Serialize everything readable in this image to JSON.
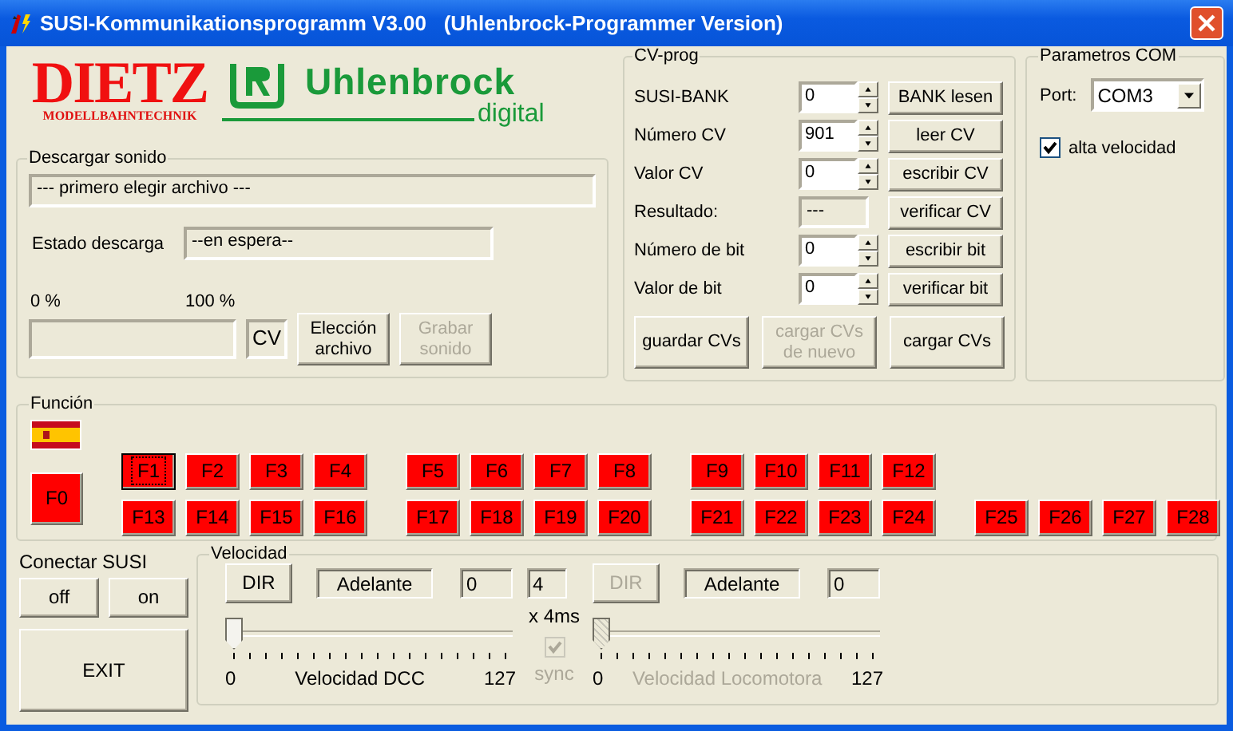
{
  "window": {
    "title": "SUSI-Kommunikationsprogramm V3.00   (Uhlenbrock-Programmer Version)"
  },
  "logos": {
    "dietz": "DIETZ",
    "dietz_sub": "MODELLBAHNTECHNIK",
    "uhlenbrock": "Uhlenbrock",
    "uhlenbrock_sub": "digital"
  },
  "download": {
    "title": "Descargar sonido",
    "file": "--- primero elegir archivo ---",
    "status_label": "Estado descarga",
    "status": "--en espera--",
    "progress_min": "0 %",
    "progress_max": "100 %",
    "progress": {
      "level": 0
    },
    "cv_box": "CV",
    "buttons": [
      {
        "label": "Elección archivo",
        "disabled": false
      },
      {
        "label": "Grabar sonido",
        "disabled": true
      }
    ]
  },
  "cv_prog": {
    "title": "CV-prog",
    "rows": [
      {
        "label": "SUSI-BANK",
        "kind": "spin",
        "value": "0",
        "button": "BANK lesen"
      },
      {
        "label": "Número CV",
        "kind": "spin",
        "value": "901",
        "button": "leer CV"
      },
      {
        "label": "Valor CV",
        "kind": "spin",
        "value": "0",
        "button": "escribir CV"
      },
      {
        "label": "Resultado:",
        "kind": "readout",
        "value": "---",
        "button": "verificar CV"
      },
      {
        "label": "Número de bit",
        "kind": "spin",
        "value": "0",
        "button": "escribir bit"
      },
      {
        "label": "Valor de bit",
        "kind": "spin",
        "value": "0",
        "button": "verificar bit"
      }
    ],
    "buttons": [
      {
        "label": "guardar CVs",
        "disabled": false
      },
      {
        "label": "cargar CVs de nuevo",
        "disabled": true
      },
      {
        "label": "cargar CVs",
        "disabled": false
      }
    ]
  },
  "com": {
    "title": "Parametros COM",
    "port_label": "Port:",
    "port": "COM3",
    "high_speed": {
      "label": "alta velocidad",
      "checked": true
    }
  },
  "functions": {
    "title": "Función",
    "f0": "F0",
    "rows": [
      [
        [
          {
            "label": "F1",
            "focused": true
          },
          {
            "label": "F2",
            "focused": false
          },
          {
            "label": "F3",
            "focused": false
          },
          {
            "label": "F4",
            "focused": false
          }
        ],
        [
          {
            "label": "F5",
            "focused": false
          },
          {
            "label": "F6",
            "focused": false
          },
          {
            "label": "F7",
            "focused": false
          },
          {
            "label": "F8",
            "focused": false
          }
        ],
        [
          {
            "label": "F9",
            "focused": false
          },
          {
            "label": "F10",
            "focused": false
          },
          {
            "label": "F11",
            "focused": false
          },
          {
            "label": "F12",
            "focused": false
          }
        ]
      ],
      [
        [
          {
            "label": "F13",
            "focused": false
          },
          {
            "label": "F14",
            "focused": false
          },
          {
            "label": "F15",
            "focused": false
          },
          {
            "label": "F16",
            "focused": false
          }
        ],
        [
          {
            "label": "F17",
            "focused": false
          },
          {
            "label": "F18",
            "focused": false
          },
          {
            "label": "F19",
            "focused": false
          },
          {
            "label": "F20",
            "focused": false
          }
        ],
        [
          {
            "label": "F21",
            "focused": false
          },
          {
            "label": "F22",
            "focused": false
          },
          {
            "label": "F23",
            "focused": false
          },
          {
            "label": "F24",
            "focused": false
          }
        ],
        [
          {
            "label": "F25",
            "focused": false
          },
          {
            "label": "F26",
            "focused": false
          },
          {
            "label": "F27",
            "focused": false
          },
          {
            "label": "F28",
            "focused": false
          }
        ]
      ]
    ]
  },
  "connect": {
    "title": "Conectar SUSI",
    "off": "off",
    "on": "on",
    "exit": "EXIT"
  },
  "speed": {
    "title": "Velocidad",
    "interval": "4",
    "interval_unit": "x 4ms",
    "sync": {
      "label": "sync",
      "checked": true,
      "disabled": true
    },
    "panels": [
      {
        "dir": "DIR",
        "disabled": false,
        "direction": "Adelante",
        "value": "0",
        "level": 0,
        "min": "0",
        "label": "Velocidad DCC",
        "max": "127"
      },
      {
        "dir": "DIR",
        "disabled": true,
        "direction": "Adelante",
        "value": "0",
        "level": 0,
        "min": "0",
        "label": "Velocidad Locomotora",
        "max": "127"
      }
    ]
  }
}
